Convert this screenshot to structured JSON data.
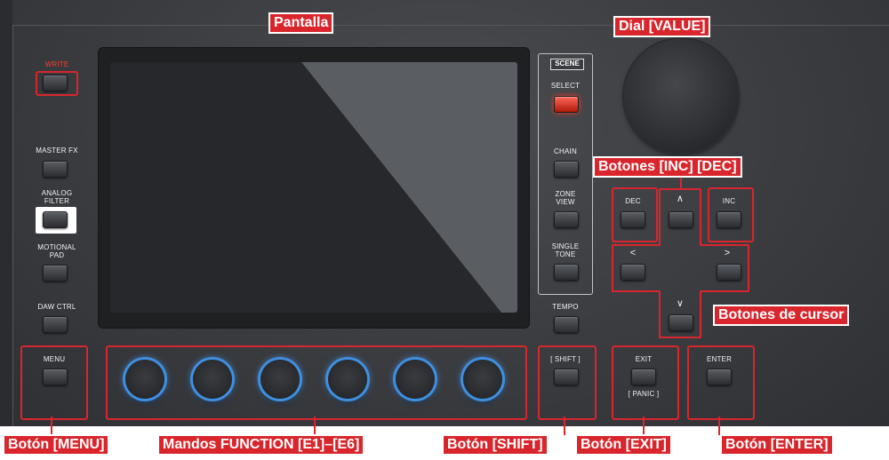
{
  "panel": {
    "write_label": "WRITE",
    "master_fx_label": "MASTER FX",
    "analog_filter_label_1": "ANALOG",
    "analog_filter_label_2": "FILTER",
    "motional_pad_label_1": "MOTIONAL",
    "motional_pad_label_2": "PAD",
    "daw_ctrl_label": "DAW CTRL",
    "menu_label": "MENU",
    "scene_title": "SCENE",
    "select_label": "SELECT",
    "chain_label": "CHAIN",
    "zone_view_label_1": "ZONE",
    "zone_view_label_2": "VIEW",
    "single_tone_label_1": "SINGLE",
    "single_tone_label_2": "TONE",
    "tempo_label": "TEMPO",
    "shift_label": "[ SHIFT ]",
    "dec_label": "DEC",
    "inc_label": "INC",
    "up_label": "∧",
    "down_label": "∨",
    "left_label": "<",
    "right_label": ">",
    "exit_label": "EXIT",
    "panic_label": "[ PANIC ]",
    "enter_label": "ENTER"
  },
  "callouts": {
    "display": "Pantalla",
    "dial": "Dial [VALUE]",
    "inc_dec": "Botones [INC] [DEC]",
    "cursor": "Botones de cursor",
    "menu": "Botón [MENU]",
    "function_knobs": "Mandos FUNCTION [E1]–[E6]",
    "shift": "Botón [SHIFT]",
    "exit": "Botón [EXIT]",
    "enter": "Botón [ENTER]"
  },
  "colors": {
    "callout_red": "#d8262c",
    "knob_ring_blue": "#3f8fe0",
    "select_led_red": "#ff3b2a",
    "write_label_red": "#ff3b2a"
  }
}
